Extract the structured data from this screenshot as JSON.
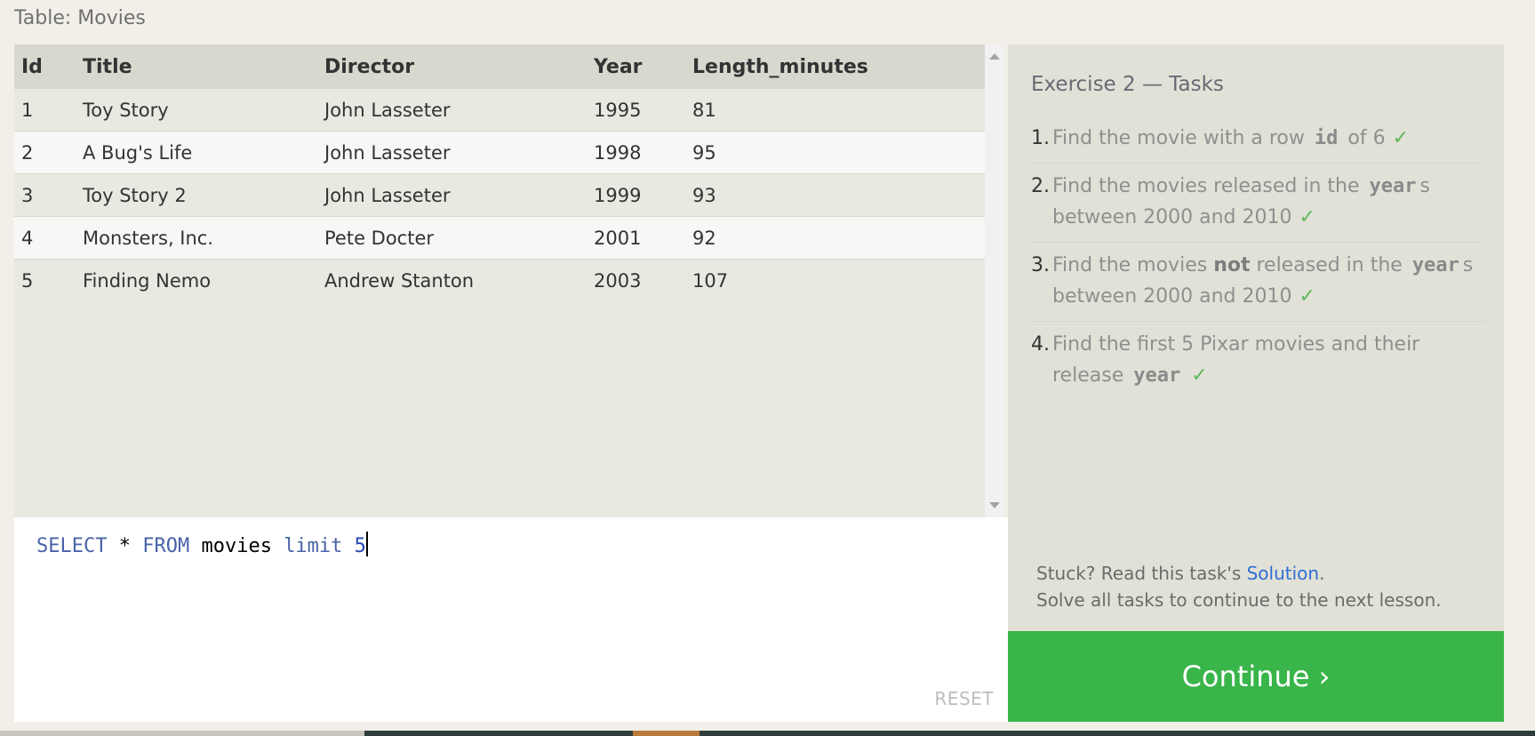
{
  "table_caption": "Table: Movies",
  "results": {
    "columns": [
      "Id",
      "Title",
      "Director",
      "Year",
      "Length_minutes"
    ],
    "rows": [
      [
        "1",
        "Toy Story",
        "John Lasseter",
        "1995",
        "81"
      ],
      [
        "2",
        "A Bug's Life",
        "John Lasseter",
        "1998",
        "95"
      ],
      [
        "3",
        "Toy Story 2",
        "John Lasseter",
        "1999",
        "93"
      ],
      [
        "4",
        "Monsters, Inc.",
        "Pete Docter",
        "2001",
        "92"
      ],
      [
        "5",
        "Finding Nemo",
        "Andrew Stanton",
        "2003",
        "107"
      ]
    ]
  },
  "editor": {
    "query_tokens": [
      "SELECT",
      " * ",
      "FROM",
      " movies ",
      "limit",
      " ",
      "5"
    ],
    "reset_label": "RESET"
  },
  "tasks": {
    "title": "Exercise 2 — Tasks",
    "items": [
      {
        "num": "1.",
        "parts": [
          "Find the movie with a row ",
          "id",
          " of 6"
        ],
        "check": "✓"
      },
      {
        "num": "2.",
        "parts": [
          "Find the movies released in the ",
          "year",
          "s between 2000 and 2010"
        ],
        "check": "✓"
      },
      {
        "num": "3.",
        "parts": [
          "Find the movies ",
          "not",
          " released in the ",
          "year",
          "s between 2000 and 2010"
        ],
        "check": "✓"
      },
      {
        "num": "4.",
        "parts": [
          "Find the first 5 Pixar movies and their release ",
          "year"
        ],
        "check": "✓"
      }
    ],
    "help_prefix": "Stuck? Read this task's ",
    "help_link": "Solution",
    "help_suffix": ".",
    "help_line2": "Solve all tasks to continue to the next lesson.",
    "continue_label": "Continue ›"
  },
  "colors": {
    "continue_bg": "#39b54a",
    "check": "#5cb85c",
    "link": "#2f6fd3",
    "keyword": "#4a63a8"
  }
}
